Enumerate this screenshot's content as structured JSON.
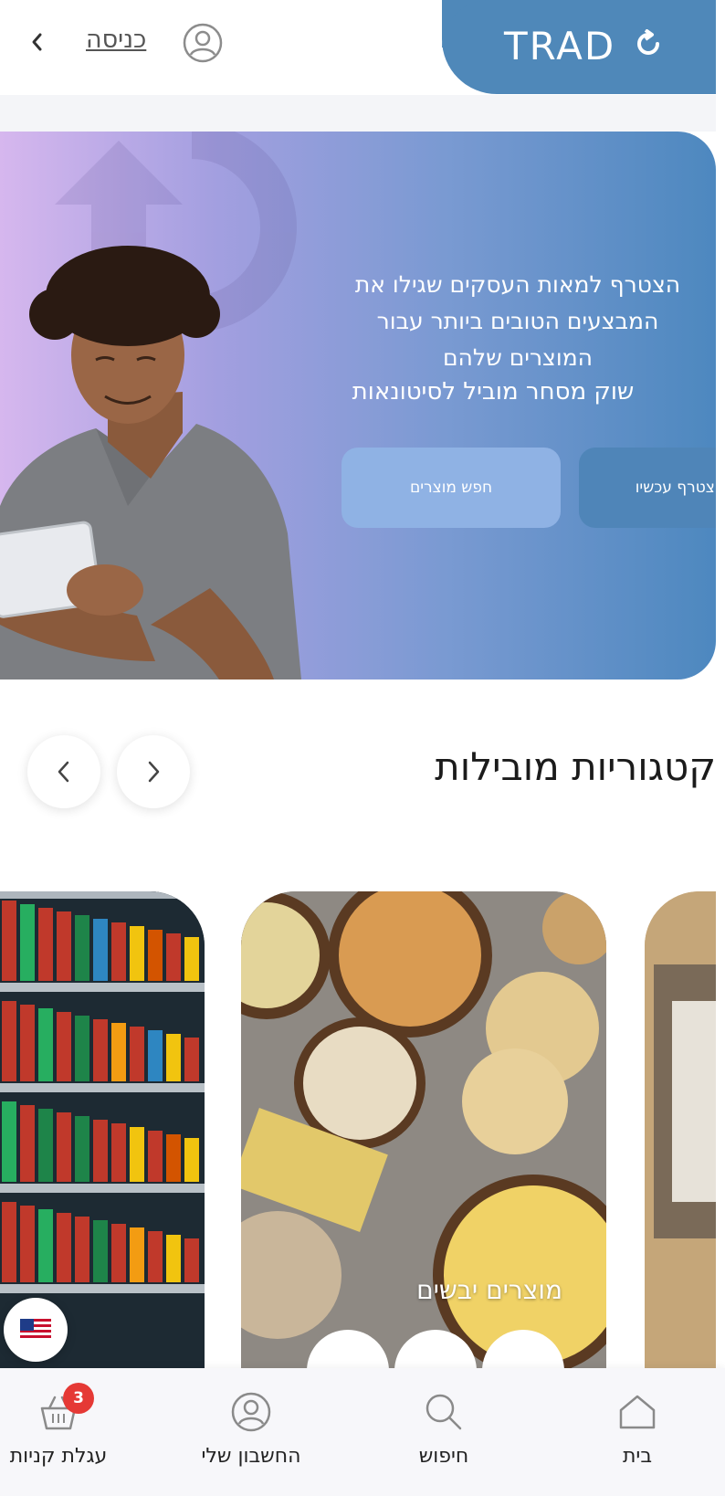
{
  "header": {
    "logo_text": "TRAD",
    "login_label": "כניסה"
  },
  "hero": {
    "title": "הצטרף למאות העסקים שגילו את המבצעים הטובים ביותר עבור המוצרים שלהם",
    "subtitle": "שוק מסחר מוביל לסיטונאות",
    "search_button": "חפש מוצרים",
    "join_button": "הצטרף עכשיו"
  },
  "categories": {
    "title": "קטגוריות מובילות",
    "cards": [
      {
        "name": "מוצרים יבשים"
      }
    ]
  },
  "bottom_nav": {
    "items": [
      {
        "label": "בית",
        "icon": "home-icon"
      },
      {
        "label": "חיפוש",
        "icon": "search-icon"
      },
      {
        "label": "החשבון שלי",
        "icon": "user-icon"
      },
      {
        "label": "עגלת קניות",
        "icon": "cart-icon"
      }
    ],
    "cart_count": "3"
  },
  "colors": {
    "brand": "#4f88b9",
    "badge": "#e53935"
  }
}
